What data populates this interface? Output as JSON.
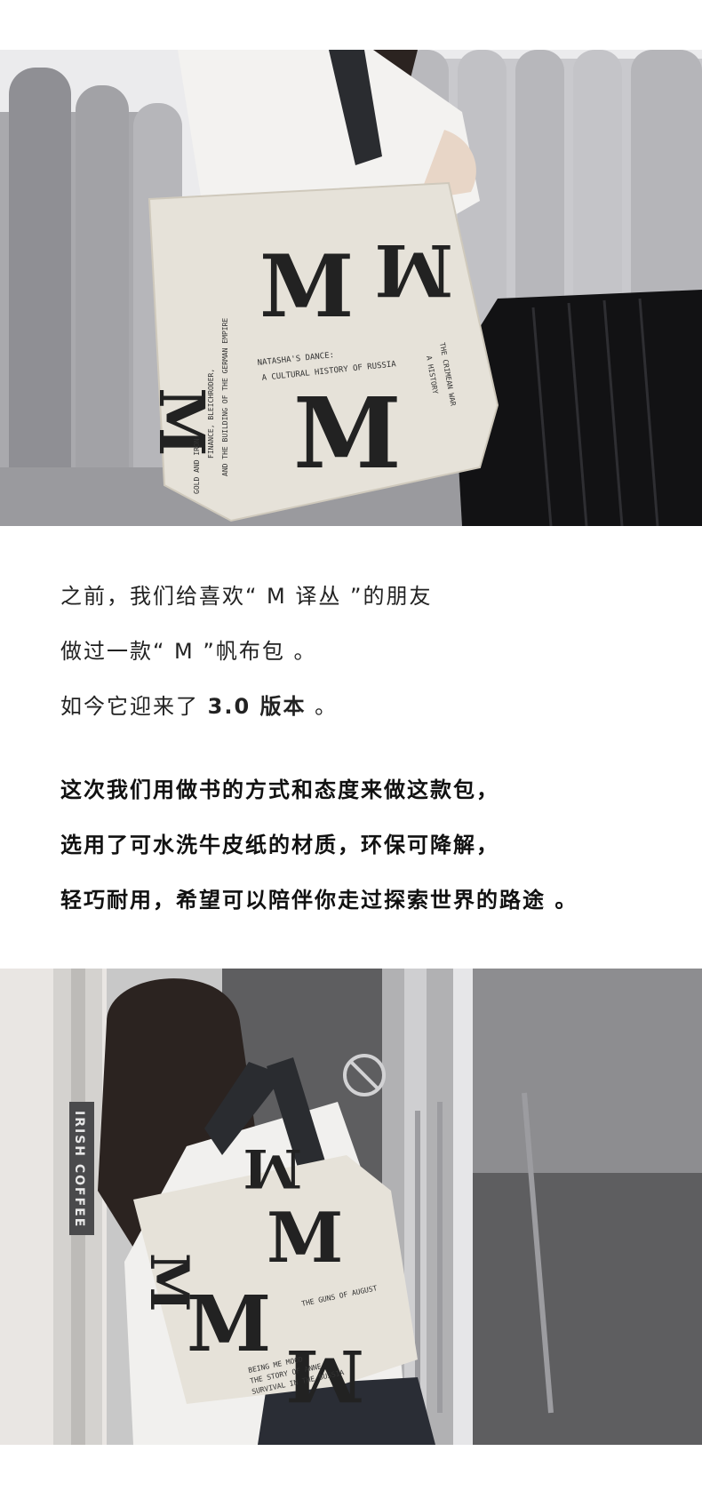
{
  "photo_top": {
    "alt": "",
    "bag_text": {
      "big_letters": [
        "M",
        "M",
        "M",
        "M"
      ],
      "line_a": "NATASHA'S DANCE:",
      "line_b": "A CULTURAL HISTORY OF RUSSIA",
      "line_c": "FINANCE, BLEICHRODER,",
      "line_d": "AND THE BUILDING OF THE GERMAN EMPIRE",
      "line_e": "GOLD AND IRON:",
      "line_f": "THE CRIMEAN WAR",
      "line_g": "A HISTORY"
    }
  },
  "intro": {
    "line1": "之前，我们给喜欢“ M 译丛 ”的朋友",
    "line2": "做过一款“ M ”帆布包 。",
    "line3_prefix": "如今它迎来了 ",
    "line3_version": "3.0 版本",
    "line3_suffix": " 。"
  },
  "statement": {
    "line1": "这次我们用做书的方式和态度来做这款包，",
    "line2": "选用了可水洗牛皮纸的材质，环保可降解，",
    "line3": "轻巧耐用，希望可以陪伴你走过探索世界的路途 。"
  },
  "photo_bottom": {
    "sign_text": "IRISH COFFEE",
    "bag_text": {
      "big_letters": [
        "M",
        "M",
        "M",
        "M",
        "M"
      ],
      "line_a": "THE GUNS OF AUGUST",
      "line_b": "BEING ME MOOD",
      "line_c": "THE STORY OF ANNE",
      "line_d": "SURVIVAL IN THE BUSSIA"
    }
  },
  "colors": {
    "ink": "#1f1f1f",
    "bag": "#e6e2d9",
    "strap": "#2a2c30"
  }
}
